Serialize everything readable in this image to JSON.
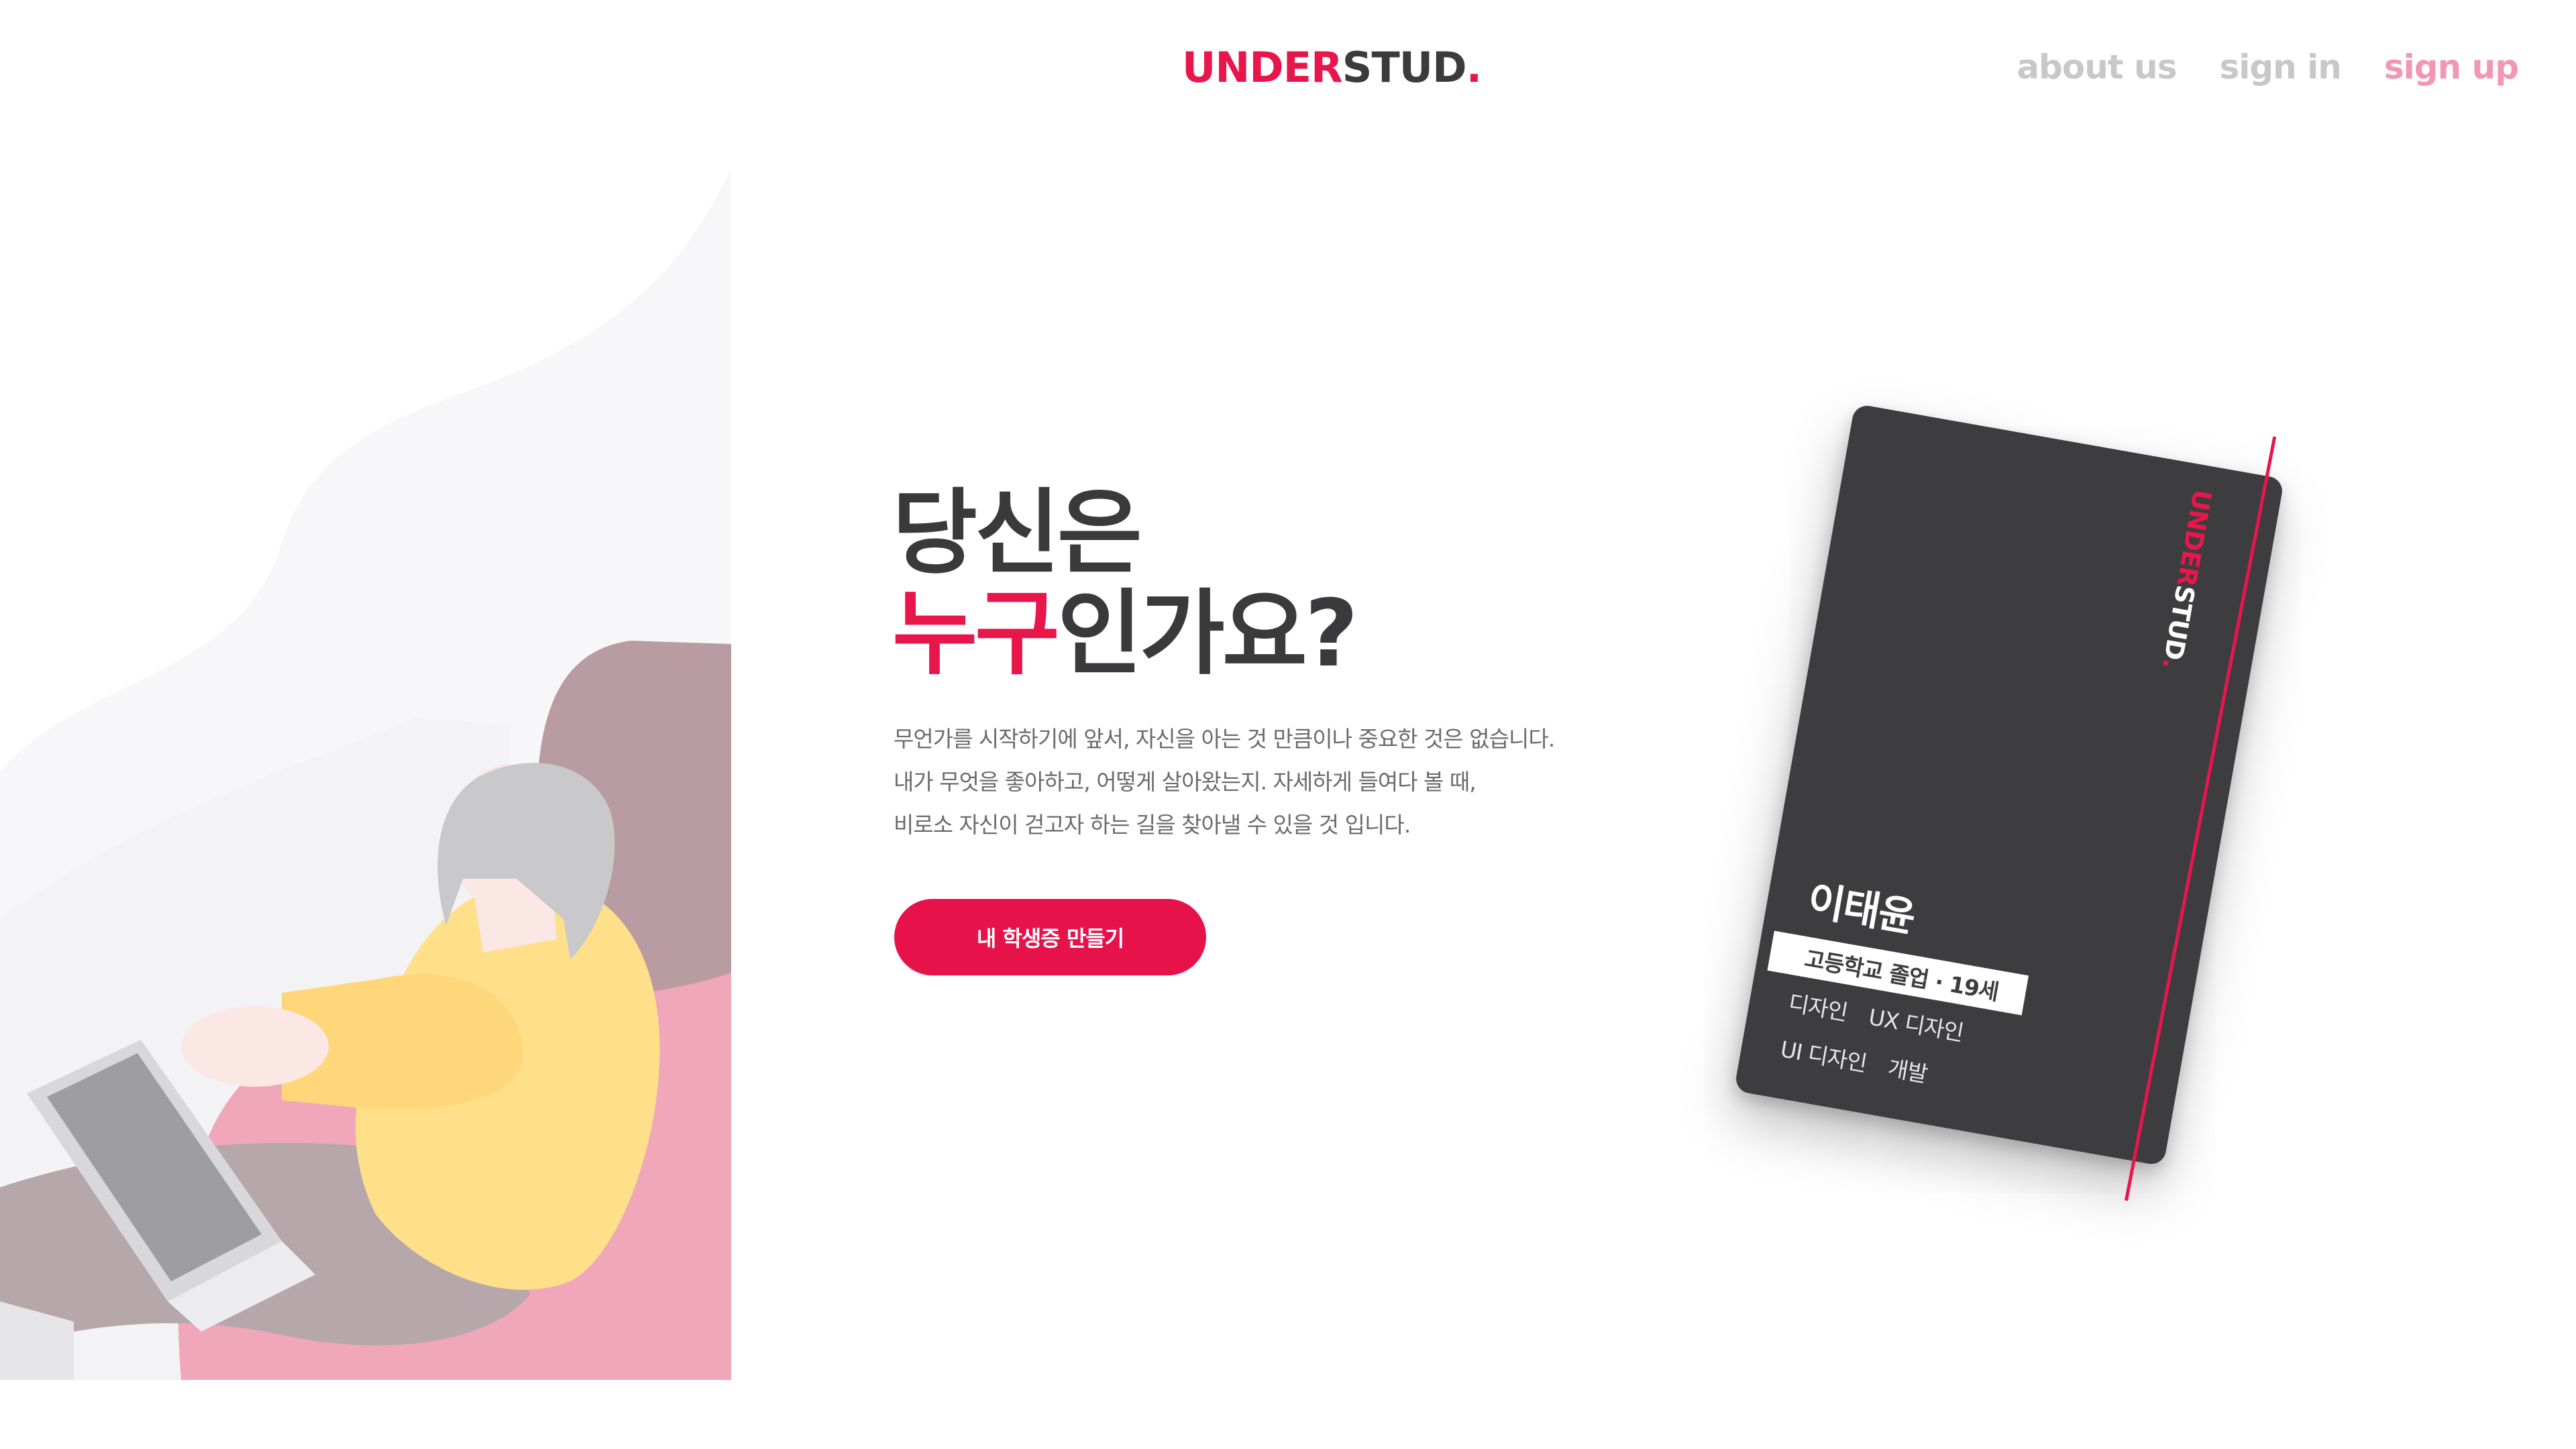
{
  "header": {
    "logo": {
      "part1": "UNDER",
      "part2": "STUD",
      "dot": "."
    },
    "nav": [
      {
        "label": "about us"
      },
      {
        "label": "sign in"
      },
      {
        "label": "sign up"
      }
    ]
  },
  "hero": {
    "title_line1": "당신은",
    "title_accent": "누구",
    "title_rest": "인가요?",
    "description": [
      "무언가를 시작하기에 앞서, 자신을 아는 것 만큼이나 중요한 것은 없습니다.",
      "내가 무엇을 좋아하고, 어떻게 살아왔는지. 자세하게 들여다 볼 때,",
      "비로소 자신이 걷고자 하는 길을 찾아낼 수 있을 것 입니다."
    ],
    "cta_label": "내 학생증 만들기"
  },
  "card": {
    "logo": {
      "part1": "UNDER",
      "part2": "STUD",
      "dot": "."
    },
    "name": "이태윤",
    "info": "고등학교 졸업 · 19세",
    "tags": [
      "디자인",
      "UX 디자인",
      "UI 디자인",
      "개발"
    ]
  },
  "colors": {
    "accent": "#e8164b",
    "text_dark": "#3a3a3c",
    "card_bg": "#3d3d3f",
    "nav_inactive": "#c8c8c8",
    "nav_active": "#f296b5"
  }
}
